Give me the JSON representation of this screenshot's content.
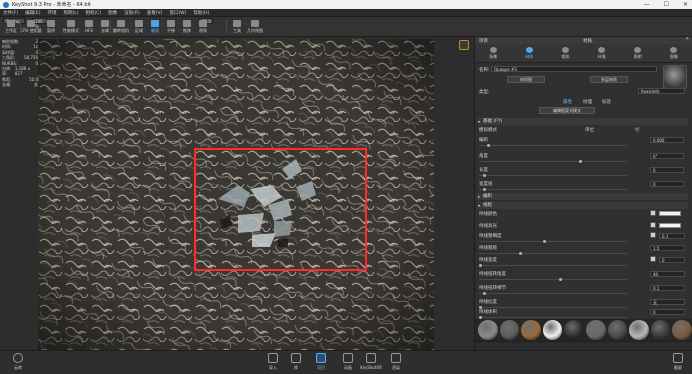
{
  "window": {
    "title": "KeyShot 9.3 Pro - 未命名 - 64 bit",
    "controls": [
      "—",
      "☐",
      "✕"
    ]
  },
  "menu": [
    "文件(F)",
    "编辑(E)",
    "环境",
    "照明(L)",
    "相机(C)",
    "图像",
    "渲染(R)",
    "查看(V)",
    "窗口(W)",
    "帮助(H)"
  ],
  "toolbar": {
    "workspace_select": "Startup",
    "percent_select": "100 %",
    "fps_value": "60.0",
    "buttons": [
      {
        "label": "工作区",
        "icon": "workspace-icon"
      },
      {
        "label": "CPU 使用量",
        "icon": "cpu-icon"
      },
      {
        "label": "暂停",
        "icon": "pause-icon"
      },
      {
        "label": "性能模式",
        "icon": "performance-icon"
      },
      {
        "label": "HFX",
        "icon": "hfx-icon"
      },
      {
        "label": "去噪",
        "icon": "denoise-icon"
      },
      {
        "label": "翻转相机",
        "icon": "flip-camera-icon"
      },
      {
        "label": "区域",
        "icon": "region-icon"
      },
      {
        "label": "翻滚",
        "icon": "tumble-icon",
        "active": true
      },
      {
        "label": "平移",
        "icon": "pan-icon"
      },
      {
        "label": "推移",
        "icon": "dolly-icon"
      },
      {
        "label": "视角",
        "icon": "fov-icon"
      },
      {
        "label": "工具",
        "icon": "tools-icon"
      },
      {
        "label": "几何视图",
        "icon": "geometry-view-icon"
      }
    ]
  },
  "stats": [
    {
      "k": "每秒帧数:",
      "v": "2"
    },
    {
      "k": "时间:",
      "v": "1s"
    },
    {
      "k": "采样值:",
      "v": "4"
    },
    {
      "k": "三角形:",
      "v": "58,756"
    },
    {
      "k": "NURBS:",
      "v": "0"
    },
    {
      "k": "分辨率:",
      "v": "1,186 x 827"
    },
    {
      "k": "焦距:",
      "v": "50.0"
    },
    {
      "k": "去噪:",
      "v": "关"
    }
  ],
  "panel": {
    "header_left": "项目",
    "header_title": "材质",
    "close": "✕",
    "tabs": [
      {
        "label": "场景",
        "icon": "scene-icon"
      },
      {
        "label": "材质",
        "icon": "material-icon",
        "active": true
      },
      {
        "label": "相机",
        "icon": "camera-icon"
      },
      {
        "label": "环境",
        "icon": "environment-icon"
      },
      {
        "label": "照明",
        "icon": "lighting-icon"
      },
      {
        "label": "图像",
        "icon": "image-icon"
      }
    ],
    "name_label": "名称:",
    "name_value": "Opaque #3",
    "btn_graph": "材质图",
    "btn_multi": "多层材质",
    "type_label": "类型:",
    "type_value": "Realcloth",
    "subtabs": [
      "属性",
      "纹理",
      "标签"
    ],
    "edit_btn": "编辑图案式模式",
    "section_base": "基础 (FY)",
    "mode_label": "模拟模式",
    "mode_opt1": "单位",
    "mode_opt2": "经",
    "props1": [
      {
        "label": "编织",
        "value": "0.000"
      },
      {
        "label": "角度",
        "value": "0°"
      },
      {
        "label": "长度",
        "value": "0"
      },
      {
        "label": "宽度值",
        "value": "0"
      }
    ],
    "section_weave": "编织",
    "section_thread": "线程",
    "props2": [
      {
        "label": "纬线颜色"
      },
      {
        "label": "纬线高光"
      },
      {
        "label": "纬线粗细度",
        "value": "0.1"
      },
      {
        "label": "纬线粗糙",
        "value": "1.5"
      },
      {
        "label": "纬线宽度",
        "value": "0"
      },
      {
        "label": "纬线扭转角度",
        "value": "40"
      },
      {
        "label": "纬线扭转细节",
        "value": "0.1"
      },
      {
        "label": "纬线捻度",
        "value": "无"
      },
      {
        "label": "纬线体积",
        "value": "0"
      }
    ],
    "colors": {
      "accent": "#55a8ea",
      "selection": "#ff2a2a"
    }
  },
  "materials": [
    "#8a8a8a",
    "#5c5c5c",
    "#9a6a3a",
    "#f0f0f0",
    "#2b2b2b",
    "#6a6a6a",
    "#4a4a4a",
    "#b8b8b8",
    "#3a3a3a",
    "#7a5a3a"
  ],
  "bottom": {
    "left": {
      "label": "云库",
      "icon": "cloud-library-icon"
    },
    "buttons": [
      {
        "label": "导入",
        "icon": "import-icon"
      },
      {
        "label": "库",
        "icon": "library-icon"
      },
      {
        "label": "项目",
        "icon": "project-icon",
        "active": true
      },
      {
        "label": "动画",
        "icon": "animation-icon"
      },
      {
        "label": "KeyShotXR",
        "icon": "keyshotxr-icon"
      },
      {
        "label": "渲染",
        "icon": "render-icon"
      }
    ],
    "right": {
      "label": "截屏",
      "icon": "screenshot-icon"
    }
  }
}
